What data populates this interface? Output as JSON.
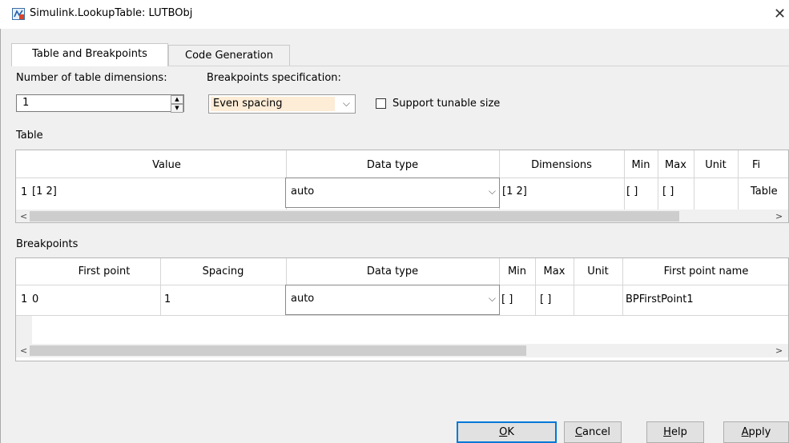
{
  "window": {
    "title": "Simulink.LookupTable: LUTBObj",
    "close_glyph": "✕"
  },
  "tabs": [
    {
      "label": "Table and Breakpoints",
      "active": true
    },
    {
      "label": "Code Generation",
      "active": false
    }
  ],
  "settings": {
    "dims_label": "Number of table dimensions:",
    "dims_value": "1",
    "bp_spec_label": "Breakpoints specification:",
    "bp_spec_value": "Even spacing",
    "tunable_label": "Support tunable size",
    "tunable_checked": false
  },
  "table_section": {
    "label": "Table",
    "columns": [
      "Value",
      "Data type",
      "Dimensions",
      "Min",
      "Max",
      "Unit",
      "Fi"
    ],
    "rows": [
      {
        "index": "1",
        "value": "[1 2]",
        "data_type": "auto",
        "dimensions": "[1 2]",
        "min": "[ ]",
        "max": "[ ]",
        "unit": "",
        "field": "Table"
      }
    ]
  },
  "breakpoints_section": {
    "label": "Breakpoints",
    "columns": [
      "First point",
      "Spacing",
      "Data type",
      "Min",
      "Max",
      "Unit",
      "First point name"
    ],
    "rows": [
      {
        "index": "1",
        "first_point": "0",
        "spacing": "1",
        "data_type": "auto",
        "min": "[ ]",
        "max": "[ ]",
        "unit": "",
        "first_point_name": "BPFirstPoint1"
      }
    ]
  },
  "buttons": {
    "ok": {
      "mn": "O",
      "rest": "K"
    },
    "cancel": {
      "mn": "C",
      "rest": "ancel"
    },
    "help": {
      "mn": "H",
      "rest": "elp"
    },
    "apply": {
      "mn": "A",
      "rest": "pply"
    }
  },
  "icons": {
    "app": "simulink-app-icon",
    "chevron": "chevron-down-icon"
  },
  "colors": {
    "accent": "#0078d7",
    "select_highlight": "#fdecd6"
  }
}
